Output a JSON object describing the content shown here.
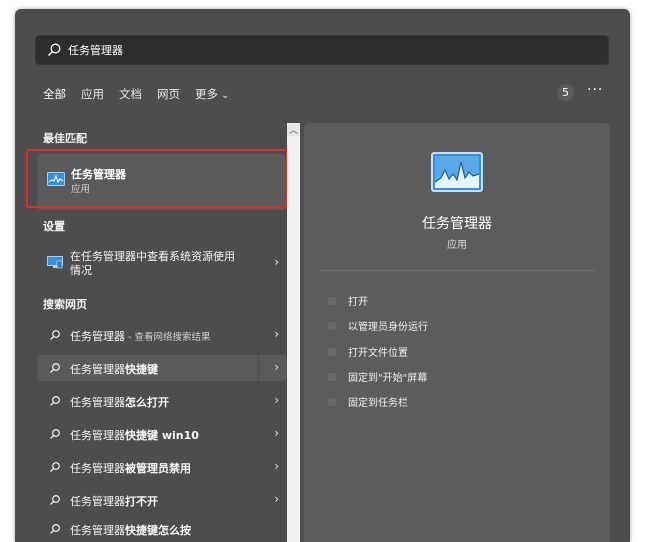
{
  "search": {
    "value": "任务管理器"
  },
  "tabs": [
    {
      "label": "全部"
    },
    {
      "label": "应用"
    },
    {
      "label": "文档"
    },
    {
      "label": "网页"
    },
    {
      "label": "更多"
    }
  ],
  "badge": "5",
  "more_menu": "···",
  "sections": {
    "best": "最佳匹配",
    "settings": "设置",
    "web": "搜索网页"
  },
  "best_match": {
    "title": "任务管理器",
    "subtitle": "应用"
  },
  "settings_item": {
    "line1": "在任务管理器中查看系统资源使用",
    "line2": "情况"
  },
  "web_results": [
    {
      "prefix": "任务管理器",
      "bold": "",
      "hint": " - 查看网络搜索结果"
    },
    {
      "prefix": "任务管理器",
      "bold": "快捷键",
      "hint": ""
    },
    {
      "prefix": "任务管理器",
      "bold": "怎么打开",
      "hint": ""
    },
    {
      "prefix": "任务管理器",
      "bold": "快捷键 win10",
      "hint": ""
    },
    {
      "prefix": "任务管理器",
      "bold": "被管理员禁用",
      "hint": ""
    },
    {
      "prefix": "任务管理器",
      "bold": "打不开",
      "hint": ""
    },
    {
      "prefix": "任务管理器",
      "bold": "快捷键怎么按",
      "hint": ""
    }
  ],
  "arrow_glyph": "›",
  "preview": {
    "title": "任务管理器",
    "subtitle": "应用",
    "actions": [
      "打开",
      "以管理员身份运行",
      "打开文件位置",
      "固定到\"开始\"屏幕",
      "固定到任务栏"
    ]
  },
  "colors": {
    "highlight_border": "#e12b2b",
    "icon_blue": "#3a8fd6"
  }
}
